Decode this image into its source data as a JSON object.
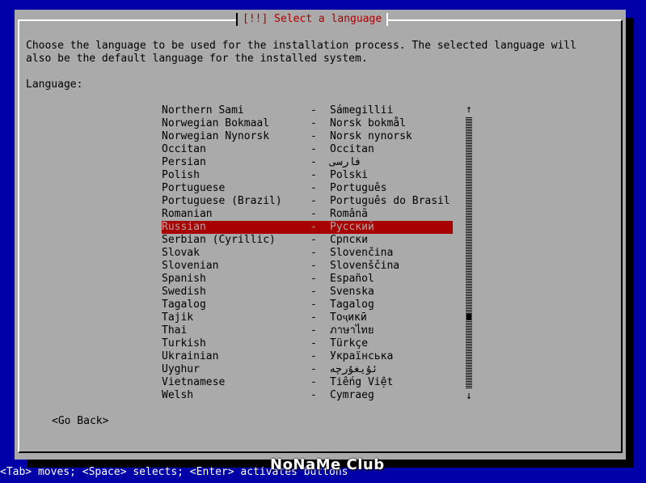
{
  "dialog": {
    "title": "[!!] Select a language",
    "description": "Choose the language to be used for the installation process. The selected language will\nalso be the default language for the installed system.",
    "language_label": "Language:"
  },
  "languages": [
    {
      "en": "Northern Sami",
      "native": "Sámegillii"
    },
    {
      "en": "Norwegian Bokmaal",
      "native": "Norsk bokmål"
    },
    {
      "en": "Norwegian Nynorsk",
      "native": "Norsk nynorsk"
    },
    {
      "en": "Occitan",
      "native": "Occitan"
    },
    {
      "en": "Persian",
      "native": "فارسی"
    },
    {
      "en": "Polish",
      "native": "Polski"
    },
    {
      "en": "Portuguese",
      "native": "Português"
    },
    {
      "en": "Portuguese (Brazil)",
      "native": "Português do Brasil"
    },
    {
      "en": "Romanian",
      "native": "Română"
    },
    {
      "en": "Russian",
      "native": "Русский",
      "selected": true
    },
    {
      "en": "Serbian (Cyrillic)",
      "native": "Српски"
    },
    {
      "en": "Slovak",
      "native": "Slovenčina"
    },
    {
      "en": "Slovenian",
      "native": "Slovenščina"
    },
    {
      "en": "Spanish",
      "native": "Español"
    },
    {
      "en": "Swedish",
      "native": "Svenska"
    },
    {
      "en": "Tagalog",
      "native": "Tagalog"
    },
    {
      "en": "Tajik",
      "native": "Тоҷикӣ"
    },
    {
      "en": "Thai",
      "native": "ภาษาไทย"
    },
    {
      "en": "Turkish",
      "native": "Türkçe"
    },
    {
      "en": "Ukrainian",
      "native": "Українська"
    },
    {
      "en": "Uyghur",
      "native": "ئۇيغۇرچە"
    },
    {
      "en": "Vietnamese",
      "native": "Tiếng Việt"
    },
    {
      "en": "Welsh",
      "native": "Cymraeg"
    }
  ],
  "separator": "-",
  "scrollbar": {
    "up_glyph": "↑",
    "down_glyph": "↓"
  },
  "buttons": {
    "go_back": "<Go Back>"
  },
  "helpbar": "<Tab> moves; <Space> selects; <Enter> activates buttons",
  "watermark": "NoNaMe Club",
  "colors": {
    "background": "#0000a8",
    "dialog": "#aaaaaa",
    "title": "#a80000",
    "selection": "#a80000"
  }
}
